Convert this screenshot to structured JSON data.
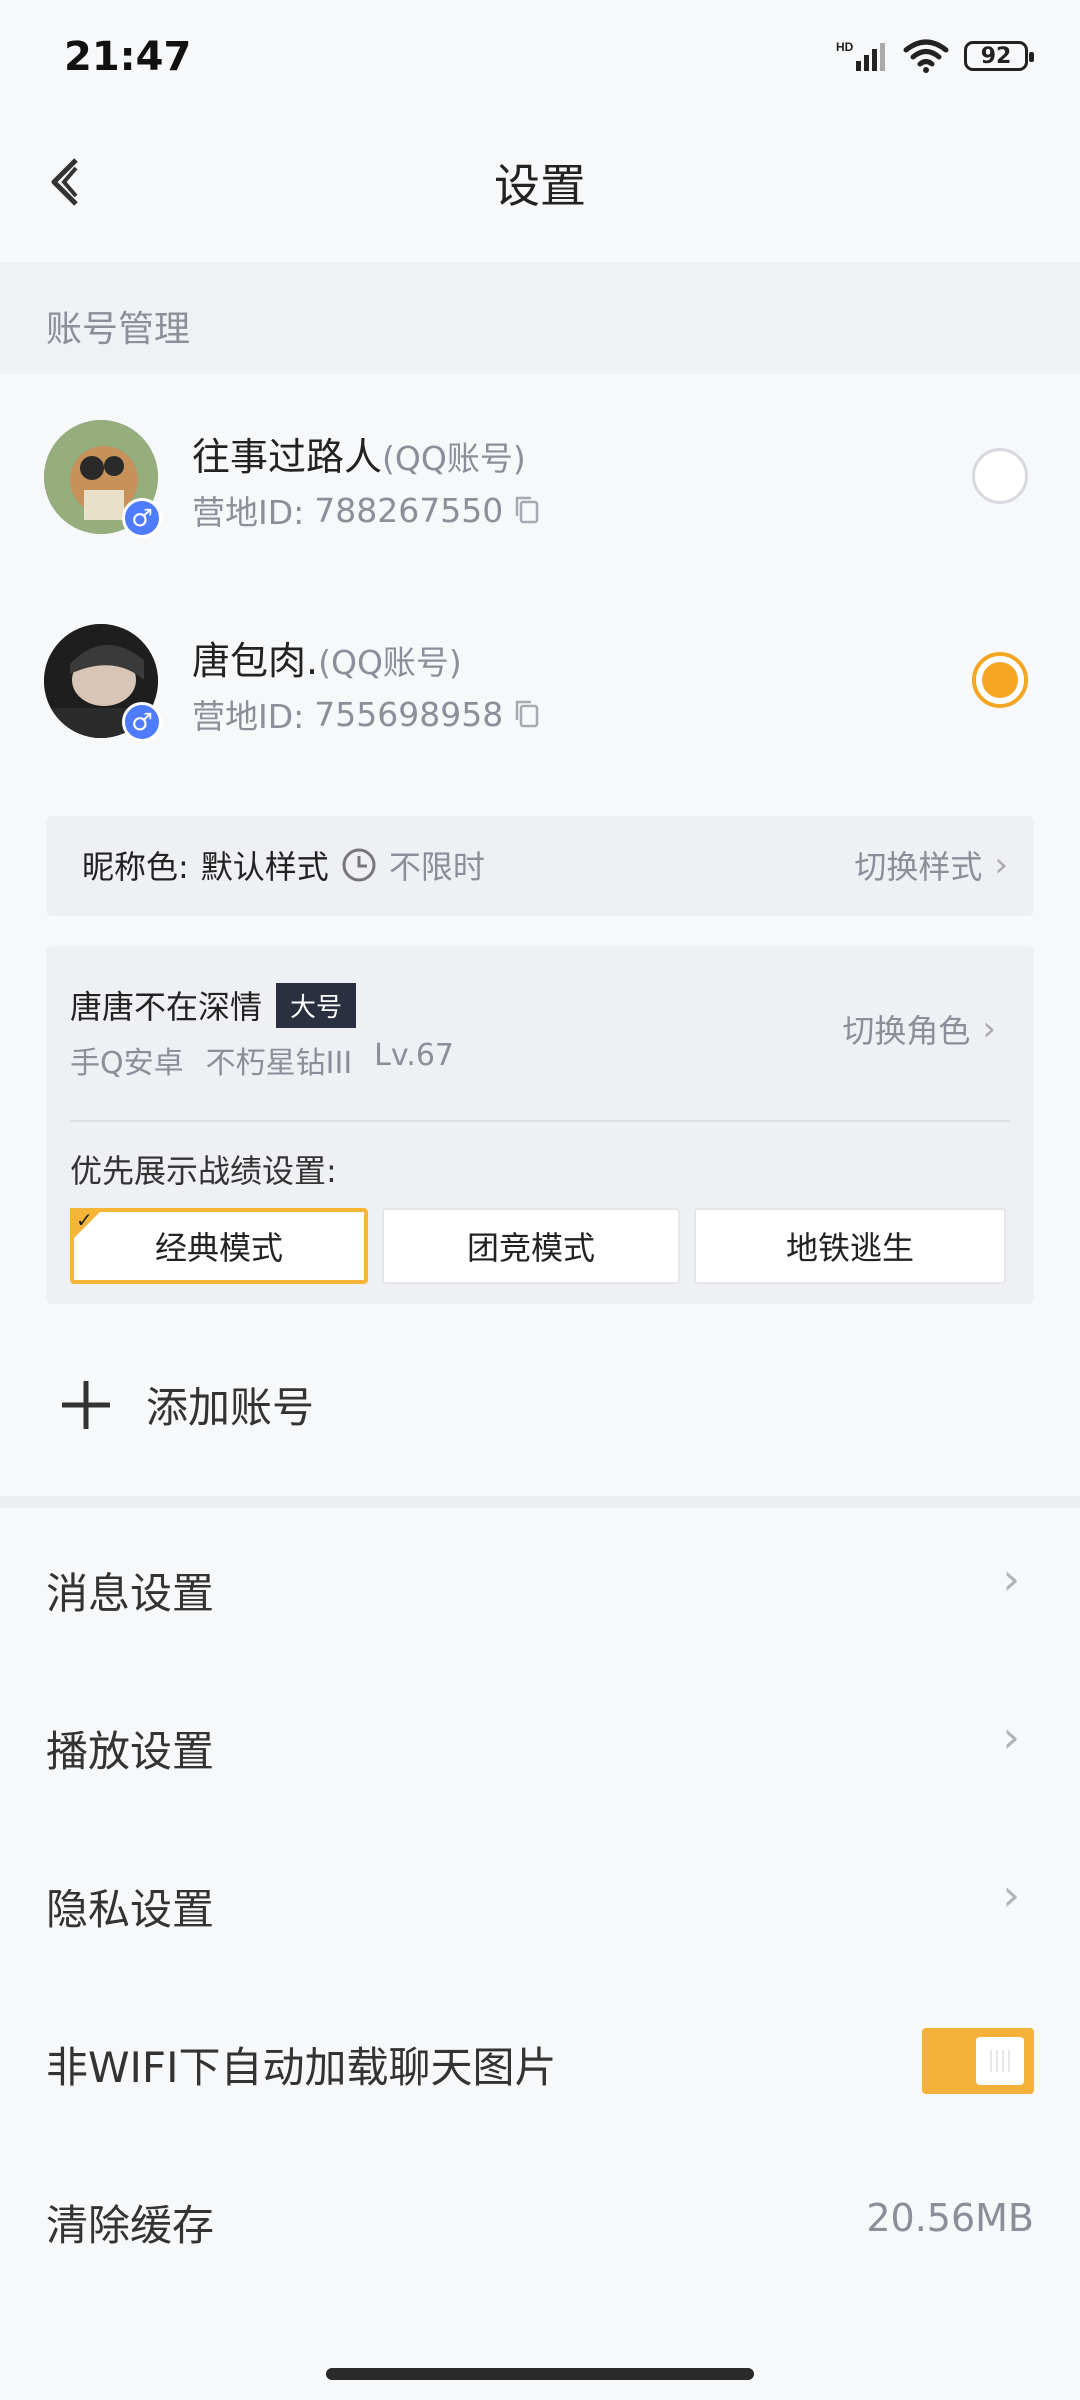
{
  "status_bar": {
    "time": "21:47",
    "battery": "92"
  },
  "header": {
    "title": "设置"
  },
  "section": {
    "account_management": "账号管理"
  },
  "accounts": [
    {
      "name": "往事过路人",
      "type": "(QQ账号)",
      "id_label": "营地ID:",
      "id": "788267550",
      "selected": false
    },
    {
      "name": "唐包肉.",
      "type": "(QQ账号)",
      "id_label": "营地ID:",
      "id": "755698958",
      "selected": true
    }
  ],
  "nickname": {
    "label": "昵称色:",
    "value": "默认样式",
    "duration": "不限时",
    "switch_label": "切换样式"
  },
  "role": {
    "name": "唐唐不在深情",
    "badge": "大号",
    "platform": "手Q安卓",
    "rank": "不朽星钻III",
    "level": "Lv.67",
    "switch_label": "切换角色",
    "priority_label": "优先展示战绩设置:",
    "modes": [
      "经典模式",
      "团竞模式",
      "地铁逃生"
    ],
    "selected_mode": "经典模式"
  },
  "add_account": {
    "label": "添加账号"
  },
  "settings": {
    "message": "消息设置",
    "playback": "播放设置",
    "privacy": "隐私设置",
    "auto_load": "非WIFI下自动加载聊天图片",
    "auto_load_enabled": true,
    "clear_cache": "清除缓存",
    "cache_size": "20.56MB"
  },
  "colors": {
    "accent": "#f5a623",
    "toggle_on": "#f5b13a",
    "gender": "#4f7cff"
  }
}
